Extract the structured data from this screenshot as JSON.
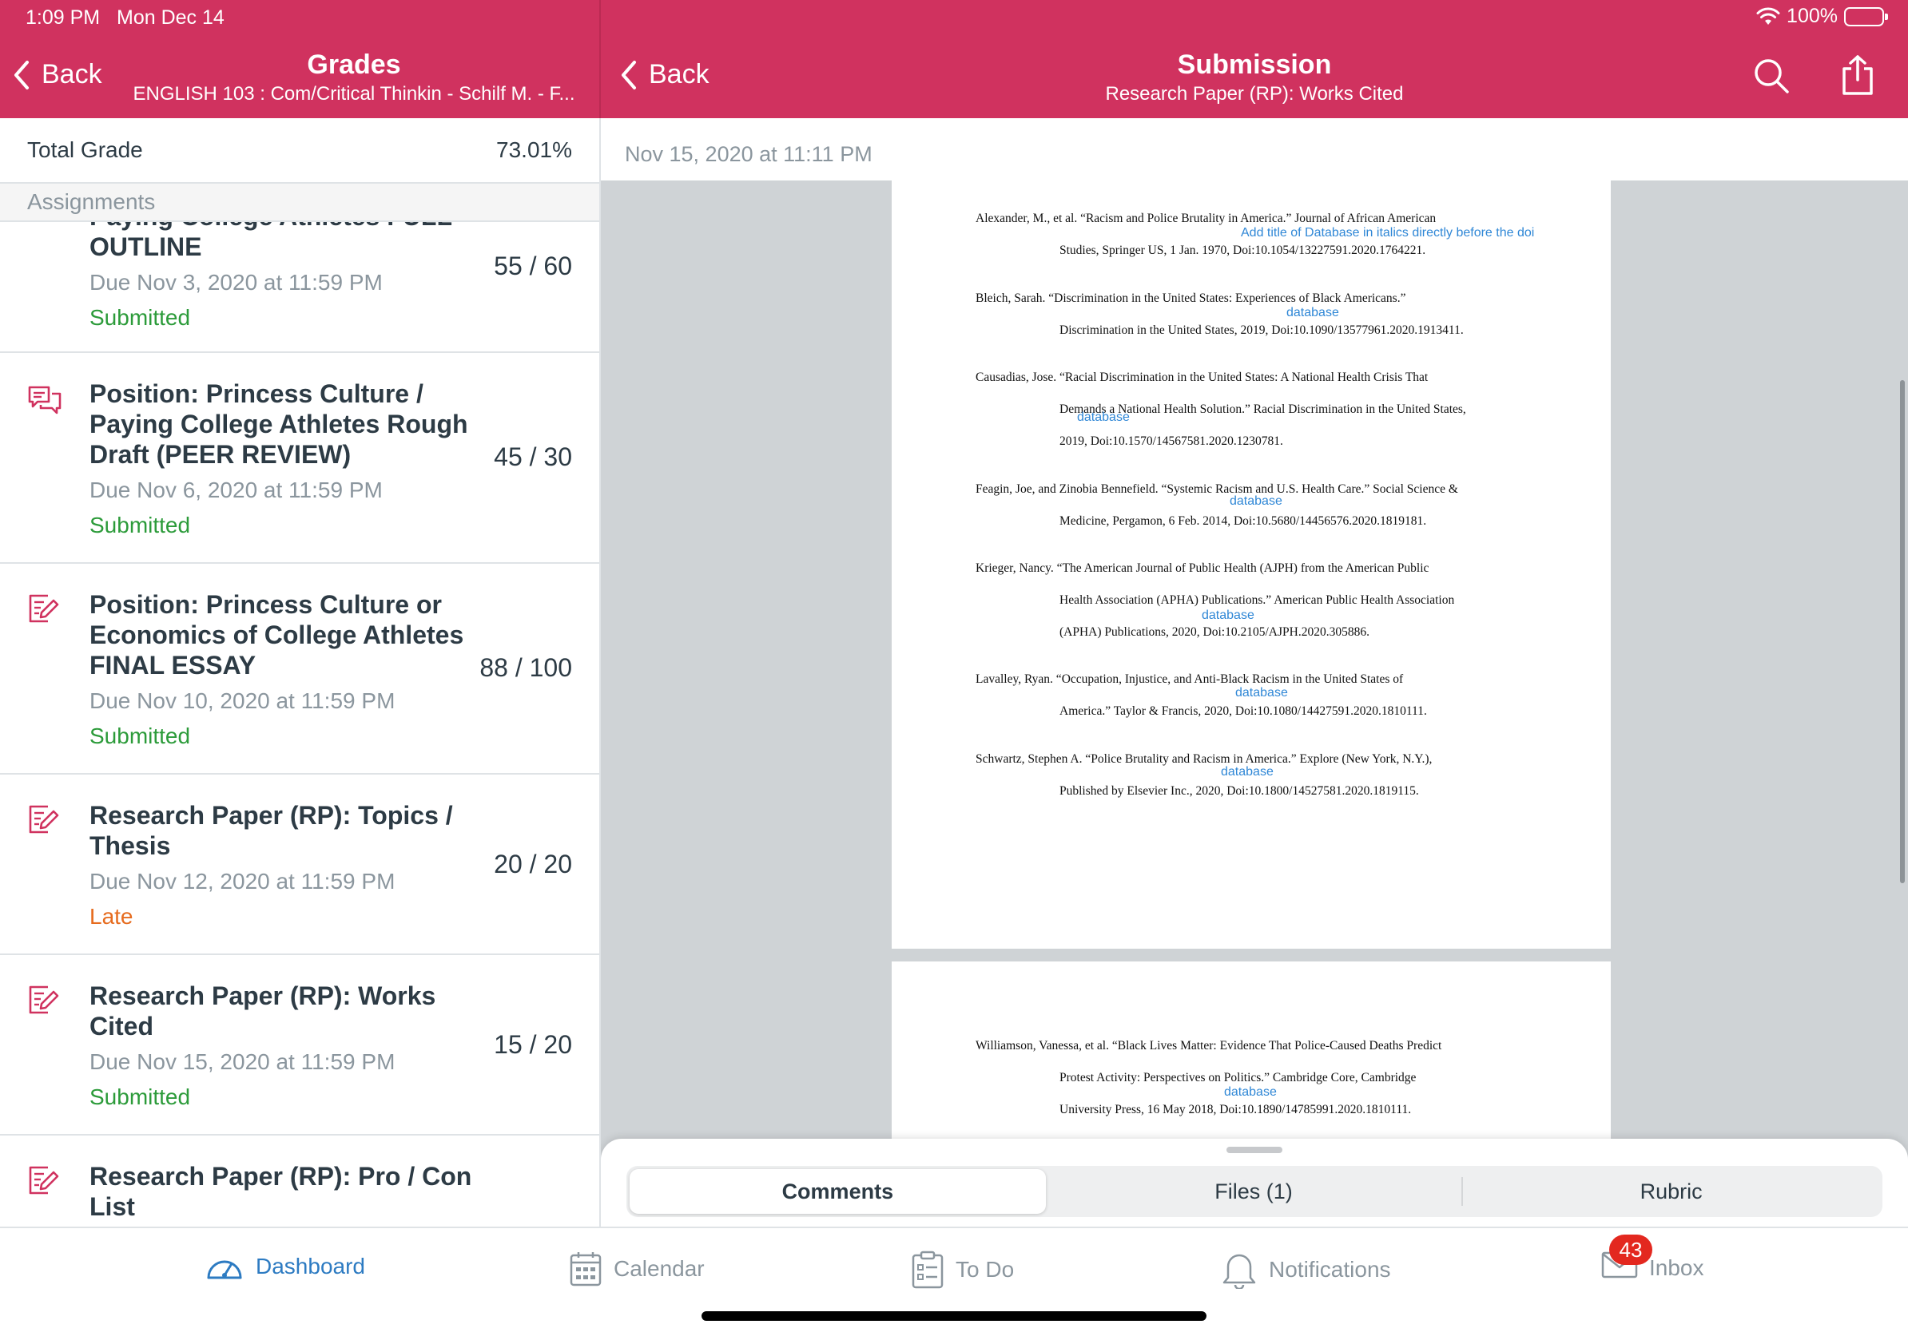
{
  "status_bar": {
    "time": "1:09 PM",
    "date": "Mon Dec 14",
    "battery": "100%"
  },
  "left_header": {
    "back_label": "Back",
    "title": "Grades",
    "subtitle": "ENGLISH 103 : Com/Critical Thinkin - Schilf M. - F..."
  },
  "right_header": {
    "back_label": "Back",
    "title": "Submission",
    "subtitle": "Research Paper (RP): Works Cited"
  },
  "grades": {
    "total_label": "Total Grade",
    "total_value": "73.01%",
    "section_label": "Assignments",
    "items": [
      {
        "title": "Paying College Athletes FULL OUTLINE",
        "due": "Due Nov 3, 2020 at 11:59 PM",
        "status": "Submitted",
        "score": "55 / 60",
        "icon": "assignment-icon"
      },
      {
        "title": "Position: Princess Culture / Paying College Athletes Rough Draft (PEER REVIEW)",
        "due": "Due Nov 6, 2020 at 11:59 PM",
        "status": "Submitted",
        "score": "45 / 30",
        "icon": "discussion-icon"
      },
      {
        "title": "Position: Princess Culture or Economics of College Athletes FINAL ESSAY",
        "due": "Due Nov 10, 2020 at 11:59 PM",
        "status": "Submitted",
        "score": "88 / 100",
        "icon": "assignment-icon"
      },
      {
        "title": "Research Paper (RP): Topics / Thesis",
        "due": "Due Nov 12, 2020 at 11:59 PM",
        "status": "Late",
        "score": "20 / 20",
        "icon": "assignment-icon"
      },
      {
        "title": "Research Paper (RP): Works Cited",
        "due": "Due Nov 15, 2020 at 11:59 PM",
        "status": "Submitted",
        "score": "15 / 20",
        "icon": "assignment-icon"
      },
      {
        "title": "Research Paper (RP): Pro / Con List",
        "due": "",
        "status": "",
        "score": "",
        "icon": "assignment-icon"
      }
    ]
  },
  "submission": {
    "date": "Nov 15, 2020 at 11:11 PM",
    "citations": [
      {
        "line1": "Alexander, M., et al. “Racism and Police Brutality in America.” Journal of African American",
        "line2": "Studies, Springer US, 1 Jan. 1970, Doi:10.1054/13227591.2020.1764221."
      },
      {
        "line1": "Bleich, Sarah. “Discrimination in the United States: Experiences of Black Americans.”",
        "line2": "Discrimination in the United States, 2019, Doi:10.1090/13577961.2020.1913411."
      },
      {
        "line1": "Causadias, Jose. “Racial Discrimination in the United States: A National Health Crisis That",
        "line2": "Demands a National Health Solution.” Racial Discrimination in the United States,",
        "line3": "2019, Doi:10.1570/14567581.2020.1230781."
      },
      {
        "line1": "Feagin, Joe, and Zinobia Bennefield. “Systemic Racism and U.S. Health Care.” Social Science &",
        "line2": "Medicine, Pergamon, 6 Feb. 2014, Doi:10.5680/14456576.2020.1819181."
      },
      {
        "line1": "Krieger, Nancy. “The American Journal of Public Health (AJPH) from the American Public",
        "line2": "Health Association (APHA) Publications.” American Public Health Association",
        "line3": "(APHA) Publications, 2020, Doi:10.2105/AJPH.2020.305886."
      },
      {
        "line1": "Lavalley, Ryan. “Occupation, Injustice, and Anti-Black Racism in the United States of",
        "line2": "America.” Taylor & Francis, 2020, Doi:10.1080/14427591.2020.1810111."
      },
      {
        "line1": "Schwartz, Stephen A. “Police Brutality and Racism in America.” Explore (New York, N.Y.),",
        "line2": "Published by Elsevier Inc., 2020, Doi:10.1800/14527581.2020.1819115."
      }
    ],
    "page2_citation": {
      "line1": "Williamson, Vanessa, et al. “Black Lives Matter: Evidence That Police-Caused Deaths Predict",
      "line2": "Protest Activity: Perspectives on Politics.” Cambridge Core, Cambridge",
      "line3": "University Press, 16 May 2018, Doi:10.1890/14785991.2020.1810111."
    },
    "annotations": {
      "a1": "Add title of Database in italics directly before the doi",
      "a2": "database",
      "a3": "database",
      "a4": "database",
      "a5": "database",
      "a6": "database",
      "a7": "database",
      "a8": "database"
    }
  },
  "sheet_tabs": {
    "comments": "Comments",
    "files": "Files (1)",
    "rubric": "Rubric"
  },
  "tabbar": {
    "dashboard": "Dashboard",
    "calendar": "Calendar",
    "todo": "To Do",
    "notifications": "Notifications",
    "inbox": "Inbox",
    "inbox_badge": "43"
  },
  "colors": {
    "brand": "#d0325f",
    "active_tab": "#2d7bc2",
    "submitted": "#2c9b3a",
    "late": "#e66b1e",
    "annotation": "#2f87d6",
    "badge": "#e3281f"
  }
}
